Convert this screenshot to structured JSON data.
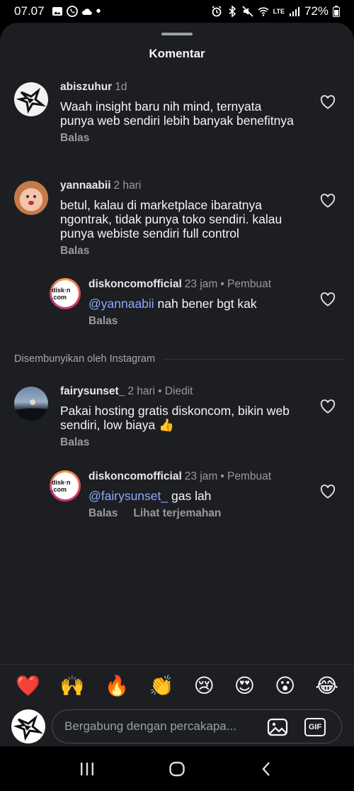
{
  "status_bar": {
    "time": "07.07",
    "battery": "72%",
    "network": "LTE"
  },
  "sheet": {
    "title": "Komentar"
  },
  "comments": [
    {
      "user": "abiszuhur",
      "meta": "1d",
      "text": "Waah insight baru nih mind, ternyata punya web sendiri lebih banyak benefitnya",
      "reply_label": "Balas"
    },
    {
      "user": "yannaabii",
      "meta": "2 hari",
      "text": "betul, kalau di marketplace ibaratnya ngontrak, tidak punya toko sendiri. kalau punya webiste sendiri full control",
      "reply_label": "Balas"
    },
    {
      "user": "diskoncomofficial",
      "meta": "23 jam",
      "role": "• Pembuat",
      "mention": "@yannaabii",
      "text": " nah bener bgt kak",
      "reply_label": "Balas"
    },
    {
      "user": "fairysunset_",
      "meta": "2 hari",
      "role": "• Diedit",
      "text": "Pakai hosting gratis diskoncom, bikin web sendiri, low biaya 👍",
      "reply_label": "Balas"
    },
    {
      "user": "diskoncomofficial",
      "meta": "23 jam",
      "role": "• Pembuat",
      "mention": "@fairysunset_",
      "text": " gas lah",
      "reply_label": "Balas",
      "translate_label": "Lihat terjemahan"
    }
  ],
  "hidden_label": "Disembunyikan oleh Instagram",
  "avatar_logo_text": "disk·n .com",
  "emoji_reactions": [
    "❤️",
    "🙌",
    "🔥",
    "👏",
    "😢",
    "😍",
    "😮",
    "😂"
  ],
  "input": {
    "placeholder": "Bergabung dengan percakapa...",
    "gif_label": "GIF"
  },
  "colors": {
    "sheet_bg": "#1c1e22",
    "mention": "#8fa7ff",
    "accent_ring": "#c13584"
  }
}
